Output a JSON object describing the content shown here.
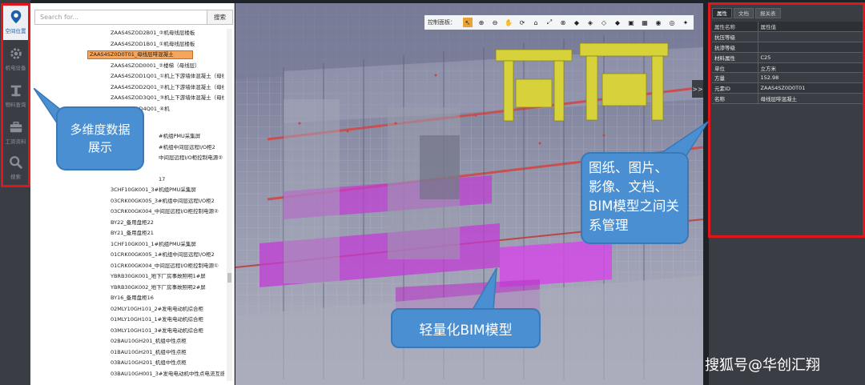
{
  "nav": {
    "items": [
      {
        "label": "空间位置",
        "icon": "location-pin-icon",
        "active": true
      },
      {
        "label": "机电设备",
        "icon": "gear-icon",
        "active": false
      },
      {
        "label": "物料查询",
        "icon": "crane-icon",
        "active": false
      },
      {
        "label": "工资资料",
        "icon": "briefcase-icon",
        "active": false
      },
      {
        "label": "搜索",
        "icon": "search-icon",
        "active": false
      }
    ]
  },
  "tree": {
    "search_placeholder": "Search for...",
    "search_button": "搜索",
    "items": [
      "ZAAS4SZOD2B01_②机母线层楼板",
      "ZAAS4SZOD1B01_①机母线层楼板",
      "ZAAS4SZ0D0T01_母线层啡混凝土",
      "ZAAS4SZOD0001_②楼梯（母线层）",
      "ZAAS4SZOD1Q01_①机上下游墙体混凝土（母线",
      "ZAAS4SZOD2Q01_②机上下游墙体混凝土（母线",
      "ZAAS4SZOD3Q01_③机上下游墙体混凝土（母线",
      "ZAAS4SZOD4Q01_④机",
      "",
      "",
      "",
      "3CHF10GK001_3#机组PMU采集屏",
      "03CRK00GK005_3#机组中间层远程I/O柜2",
      "03CRK00GK004_中间层远程I/O柜控制电源②",
      "BY22_备用盘柜22",
      "BY21_备用盘柜21",
      "1CHF10GK001_1#机组PMU采集屏",
      "01CRK00GK005_1#机组中间层远程I/O柜2",
      "01CRK00GK004_中间层远程I/O柜控制电源①",
      "YBRB30GK001_地下厂房事故照明1#屏",
      "YBRB30GK002_地下厂房事故照明2#屏",
      "BY16_备用盘柜16",
      "02MLY10GH101_2#发电电动机综合柜",
      "01MLY10GH101_1#发电电动机综合柜",
      "03MLY10GH101_3#发电电动机综合柜",
      "02BAU10GH201_机组中性点柜",
      "01BAU10GH201_机组中性点柜",
      "03BAU10GH201_机组中性点柜",
      "03BAU10GH001_3#发电电动机中性点电流互感"
    ],
    "partial_items": [
      "#机组PMU采集屏",
      "#机组中间层远程I/O柜2",
      "中间层远程I/O柜控制电源②",
      "17"
    ],
    "selected_index": 2
  },
  "viewport": {
    "control_label": "控制面板：",
    "expand_label": ">>"
  },
  "callouts": {
    "multi_dim": "多维度数据展示",
    "lightweight": "轻量化BIM模型",
    "relations": "图纸、图片、影像、文档、BIM模型之间关系管理"
  },
  "properties": {
    "tabs": [
      "属性",
      "文档",
      "报关表"
    ],
    "active_tab": 0,
    "header": {
      "name": "属性名称",
      "value": "属性值"
    },
    "rows": [
      {
        "name": "抗压等级",
        "value": ""
      },
      {
        "name": "抗渗等级",
        "value": ""
      },
      {
        "name": "材料属性",
        "value": "C25"
      },
      {
        "name": "单位",
        "value": "立方米"
      },
      {
        "name": "方量",
        "value": "152.98"
      },
      {
        "name": "元素ID",
        "value": "ZAAS4SZ0D0T01"
      },
      {
        "name": "名称",
        "value": "母线层啡混凝土"
      }
    ]
  },
  "watermark": "搜狐号@华创汇翔",
  "colors": {
    "rail_bg": "#3a3e44",
    "highlight_red": "#e0161a",
    "callout_blue": "#4a8fd1",
    "selection_orange": "#f5a55c",
    "model_magenta": "#c23bd6",
    "model_yellow": "#d7d23a",
    "control_active": "#e8a338"
  }
}
